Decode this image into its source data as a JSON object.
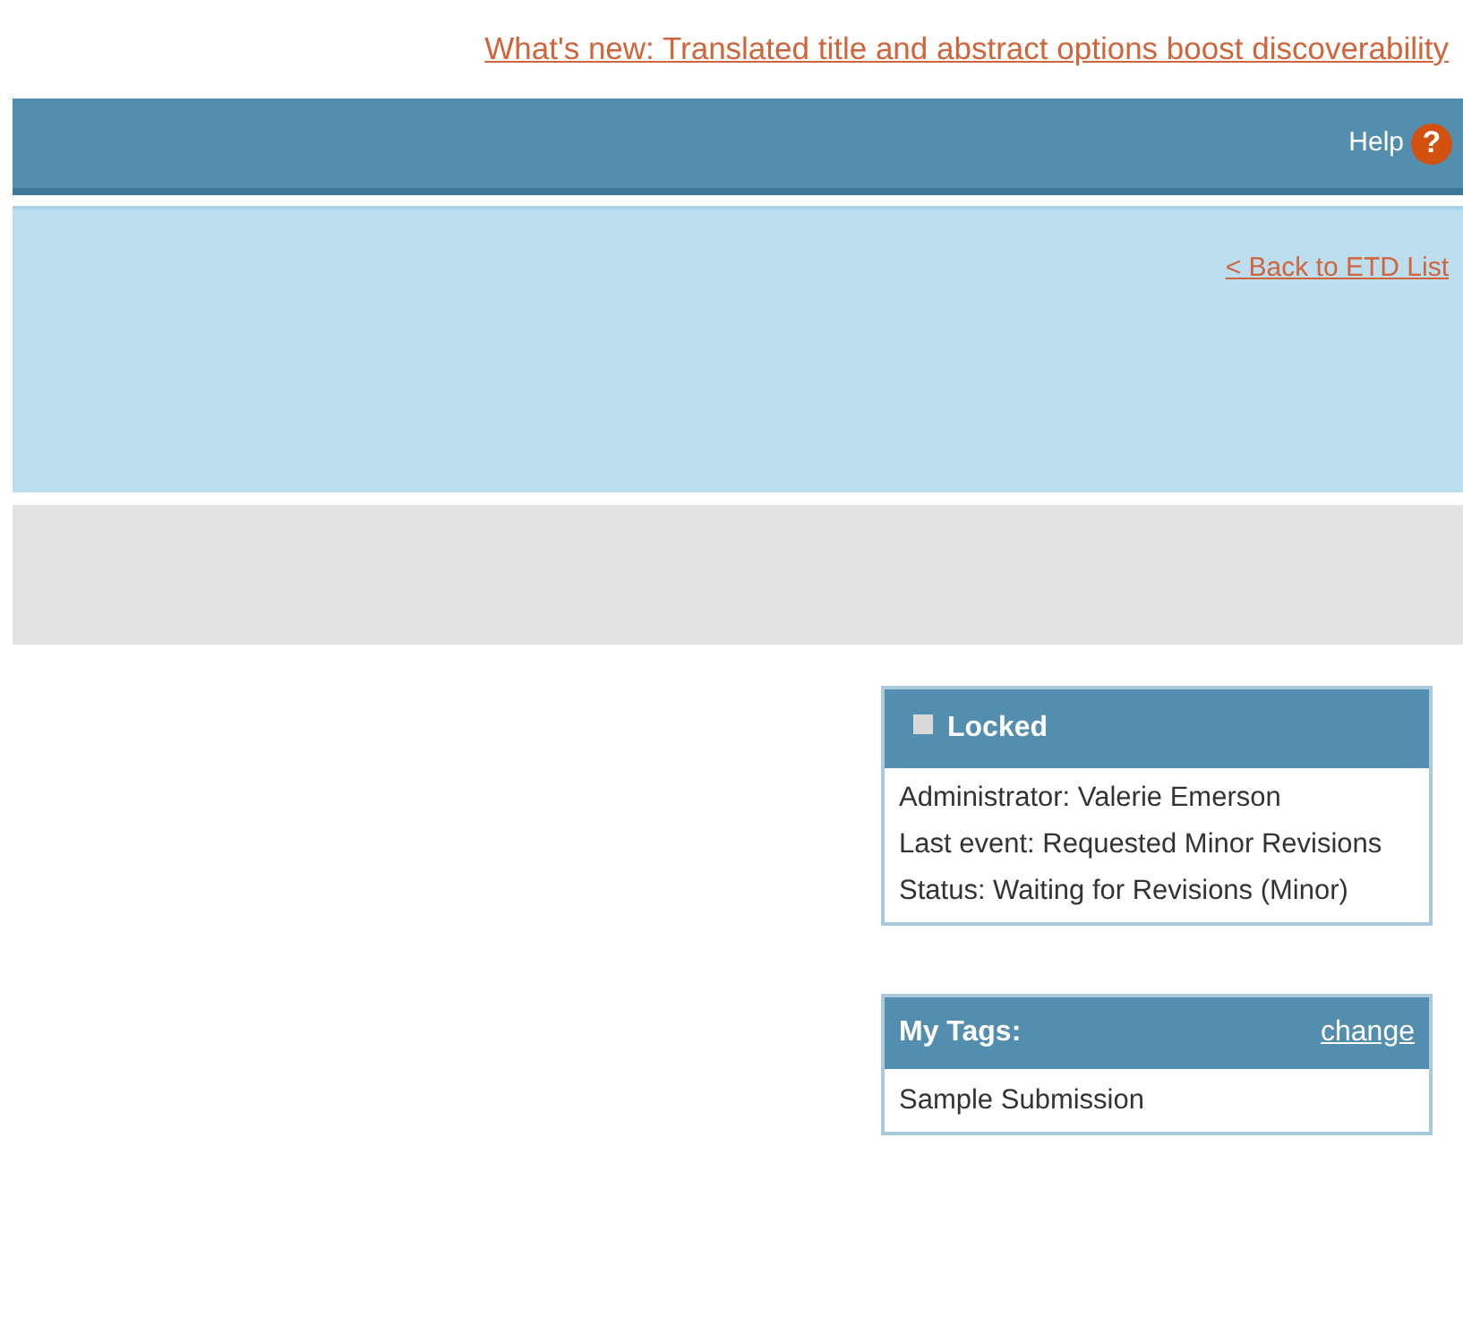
{
  "announcement": {
    "text": "What's new: Translated title and abstract options boost discoverability"
  },
  "header": {
    "help_label": "Help",
    "help_icon": "?"
  },
  "subheader": {
    "back_link": "< Back to ETD List"
  },
  "status_panel": {
    "title": "Locked",
    "checked": false,
    "lines": [
      "Administrator: Valerie Emerson",
      "Last event: Requested Minor Revisions",
      "Status: Waiting for Revisions (Minor)"
    ]
  },
  "tags_panel": {
    "title": "My Tags:",
    "change_link": "change",
    "tags": [
      "Sample Submission"
    ]
  }
}
